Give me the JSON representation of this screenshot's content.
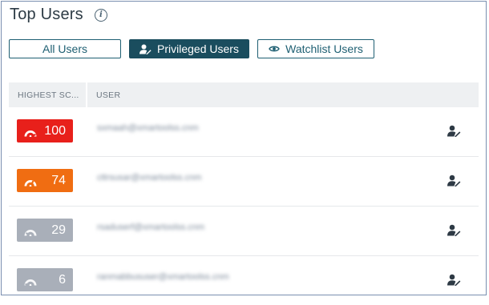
{
  "header": {
    "title": "Top Users",
    "info_icon": "info-icon"
  },
  "filters": [
    {
      "label": "All Users",
      "active": false
    },
    {
      "label": "Privileged Users",
      "icon": "privileged-user-icon",
      "active": true
    },
    {
      "label": "Watchlist Users",
      "icon": "eye-icon",
      "active": false
    }
  ],
  "table": {
    "columns": [
      "HIGHEST SC...",
      "USER"
    ],
    "rows": [
      {
        "score": "100",
        "level": "critical",
        "color": "#e8201b",
        "user": "sxmaah@xmartoolss.cnm"
      },
      {
        "score": "74",
        "level": "high",
        "color": "#f06d12",
        "user": "cttrsusar@xmartoolss.cnm"
      },
      {
        "score": "29",
        "level": "low",
        "color": "#a9afb9",
        "user": "rsaduserf@xmartoolss.cnm"
      },
      {
        "score": "6",
        "level": "low",
        "color": "#a9afb9",
        "user": "ranmabbususer@xmartoolss.cnm"
      }
    ],
    "row_action_icon": "privileged-user-icon"
  }
}
